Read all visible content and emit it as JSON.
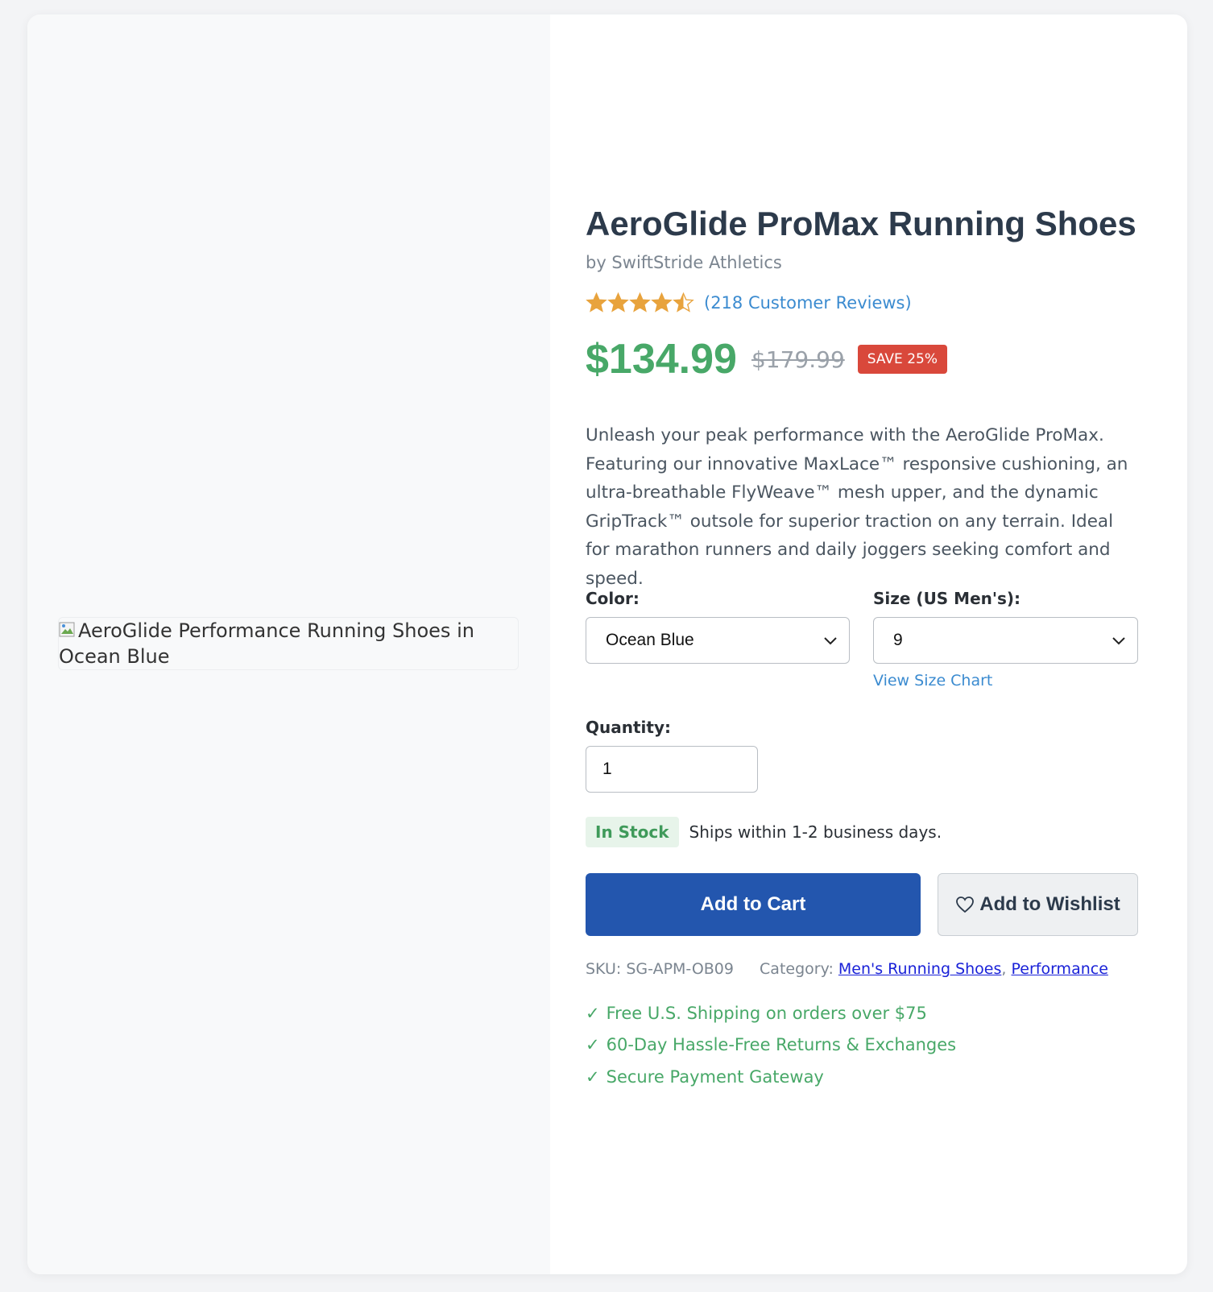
{
  "product": {
    "image_alt": "AeroGlide Performance Running Shoes in Ocean Blue",
    "title": "AeroGlide ProMax Running Shoes",
    "brand": "by SwiftStride Athletics",
    "rating": {
      "value": 4.5,
      "max": 5,
      "reviews_label": "(218 Customer Reviews)"
    },
    "price": {
      "current": "$134.99",
      "original": "$179.99",
      "save_badge": "SAVE 25%"
    },
    "description": "Unleash your peak performance with the AeroGlide ProMax. Featuring our innovative MaxLace™ responsive cushioning, an ultra-breathable FlyWeave™ mesh upper, and the dynamic GripTrack™ outsole for superior traction on any terrain. Ideal for marathon runners and daily joggers seeking comfort and speed."
  },
  "options": {
    "color_label": "Color:",
    "color_value": "Ocean Blue",
    "size_label": "Size (US Men's):",
    "size_value": "9",
    "size_chart_link": "View Size Chart",
    "quantity_label": "Quantity:",
    "quantity_value": "1"
  },
  "stock": {
    "badge": "In Stock",
    "shipping": "Ships within 1-2 business days."
  },
  "actions": {
    "add_to_cart": "Add to Cart",
    "add_to_wishlist": "Add to Wishlist"
  },
  "meta": {
    "sku": "SKU: SG-APM-OB09",
    "category_label": "Category:",
    "categories": [
      "Men's Running Shoes",
      "Performance"
    ],
    "separator": ","
  },
  "perks": [
    "Free U.S. Shipping on orders over $75",
    "60-Day Hassle-Free Returns & Exchanges",
    "Secure Payment Gateway"
  ],
  "icons": {
    "star": "star-icon",
    "chevron": "chevron-down-icon",
    "heart": "heart-outline-icon",
    "check": "checkmark-icon",
    "broken_image": "broken-image-icon"
  },
  "colors": {
    "accent_green": "#48a868",
    "primary_blue": "#2356ae",
    "link_blue": "#3b8bd0",
    "sale_red": "#d9483b",
    "star_gold": "#e8a33d",
    "title_dark": "#2c3a4b"
  }
}
